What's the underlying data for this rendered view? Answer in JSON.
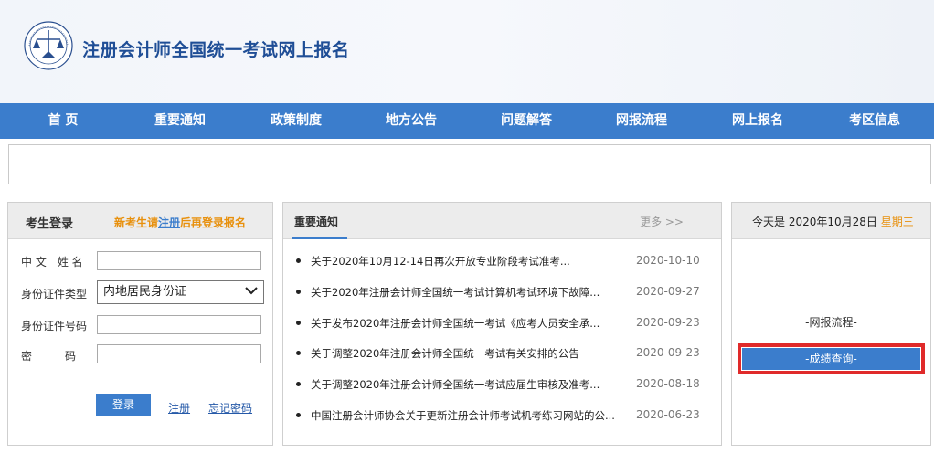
{
  "header": {
    "title": "注册会计师全国统一考试网上报名",
    "logo": "cicpa-logo"
  },
  "nav": [
    "首 页",
    "重要通知",
    "政策制度",
    "地方公告",
    "问题解答",
    "网报流程",
    "网上报名",
    "考区信息"
  ],
  "login": {
    "title": "考生登录",
    "hint_before": "新考生请",
    "hint_link": "注册",
    "hint_after": "后再登录报名",
    "name_label": "中 文　姓 名",
    "id_type_label": "身份证件类型",
    "id_type_value": "内地居民身份证",
    "id_number_label": "身份证件号码",
    "password_label": "密　　　码",
    "login_button": "登录",
    "register_link": "注册",
    "forgot_link": "忘记密码"
  },
  "notices": {
    "title": "重要通知",
    "more": "更多 >>",
    "items": [
      {
        "title": "关于2020年10月12-14日再次开放专业阶段考试准考...",
        "date": "2020-10-10"
      },
      {
        "title": "关于2020年注册会计师全国统一考试计算机考试环境下故障...",
        "date": "2020-09-27"
      },
      {
        "title": "关于发布2020年注册会计师全国统一考试《应考人员安全承...",
        "date": "2020-09-23"
      },
      {
        "title": "关于调整2020年注册会计师全国统一考试有关安排的公告",
        "date": "2020-09-23"
      },
      {
        "title": "关于调整2020年注册会计师全国统一考试应届生审核及准考...",
        "date": "2020-08-18"
      },
      {
        "title": "中国注册会计师协会关于更新注册会计师考试机考练习网站的公...",
        "date": "2020-06-23"
      }
    ]
  },
  "sidebar": {
    "today_prefix": "今天是 2020年10月28日",
    "weekday": "星期三",
    "flow_link": "-网报流程-",
    "query_button": "-成绩查询-"
  },
  "colors": {
    "primary": "#3b7dcc",
    "accent": "#e8900c",
    "highlight": "#e02a2a",
    "title": "#1f4e96"
  }
}
